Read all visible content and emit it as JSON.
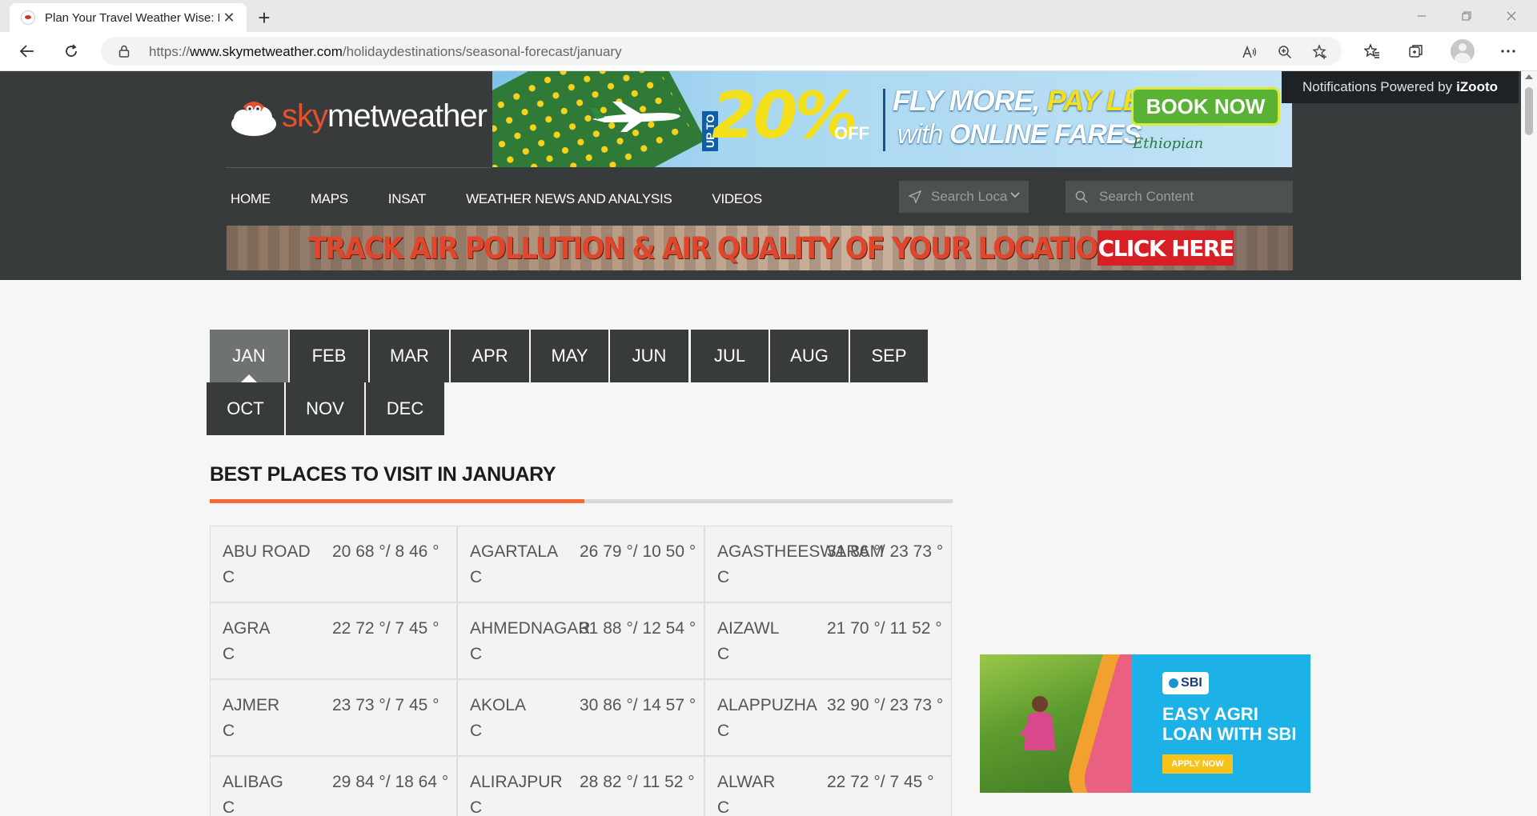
{
  "browser": {
    "tab_title": "Plan Your Travel Weather Wise: B",
    "tab_close": "✕",
    "new_tab": "+",
    "url_prefix": "https://",
    "url_host": "www.skymetweather.com",
    "url_path": "/holidaydestinations/seasonal-forecast/january"
  },
  "site": {
    "logo_sky": "sky",
    "logo_rest": "metweather",
    "nav": [
      "HOME",
      "MAPS",
      "INSAT",
      "WEATHER NEWS AND ANALYSIS",
      "VIDEOS"
    ],
    "search_location_placeholder": "Search Loca",
    "search_content_placeholder": "Search Content",
    "notification": "Notifications Powered by",
    "notification_brand": "iZooto"
  },
  "ads": {
    "top_upto": "UP TO",
    "top_percent": "20%",
    "top_off": "OFF",
    "top_line1_a": "FLY MORE,",
    "top_line1_b": "PAY LESS",
    "top_line2_a": "with",
    "top_line2_b": "ONLINE FARES",
    "top_cta": "BOOK NOW",
    "top_airline": "Ethiopian",
    "air_text": "TRACK AIR POLLUTION & AIR QUALITY OF YOUR LOCATION",
    "air_cta": "CLICK HERE",
    "sbi_logo": "SBI",
    "sbi_line1": "EASY AGRI",
    "sbi_line2": "LOAN WITH SBI",
    "sbi_cta": "APPLY NOW"
  },
  "months": [
    "JAN",
    "FEB",
    "MAR",
    "APR",
    "MAY",
    "JUN",
    "JUL",
    "AUG",
    "SEP",
    "OCT",
    "NOV",
    "DEC"
  ],
  "active_month": "JAN",
  "section_title": "BEST PLACES TO VISIT IN JANUARY",
  "places": [
    {
      "name": "ABU ROAD",
      "temp": "20 68 °/ 8 46 °",
      "unit": "C"
    },
    {
      "name": "AGARTALA",
      "temp": "26 79 °/ 10 50 °",
      "unit": "C"
    },
    {
      "name": "AGASTHEESWARAM",
      "temp": "31 86 °/ 23 73 °",
      "unit": "C"
    },
    {
      "name": "AGRA",
      "temp": "22 72 °/ 7 45 °",
      "unit": "C"
    },
    {
      "name": "AHMEDNAGAR",
      "temp": "31 88 °/ 12 54 °",
      "unit": "C"
    },
    {
      "name": "AIZAWL",
      "temp": "21 70 °/ 11 52 °",
      "unit": "C"
    },
    {
      "name": "AJMER",
      "temp": "23 73 °/ 7 45 °",
      "unit": "C"
    },
    {
      "name": "AKOLA",
      "temp": "30 86 °/ 14 57 °",
      "unit": "C"
    },
    {
      "name": "ALAPPUZHA",
      "temp": "32 90 °/ 23 73 °",
      "unit": "C"
    },
    {
      "name": "ALIBAG",
      "temp": "29 84 °/ 18 64 °",
      "unit": "C"
    },
    {
      "name": "ALIRAJPUR",
      "temp": "28 82 °/ 11 52 °",
      "unit": "C"
    },
    {
      "name": "ALWAR",
      "temp": "22 72 °/ 7 45 °",
      "unit": "C"
    }
  ]
}
